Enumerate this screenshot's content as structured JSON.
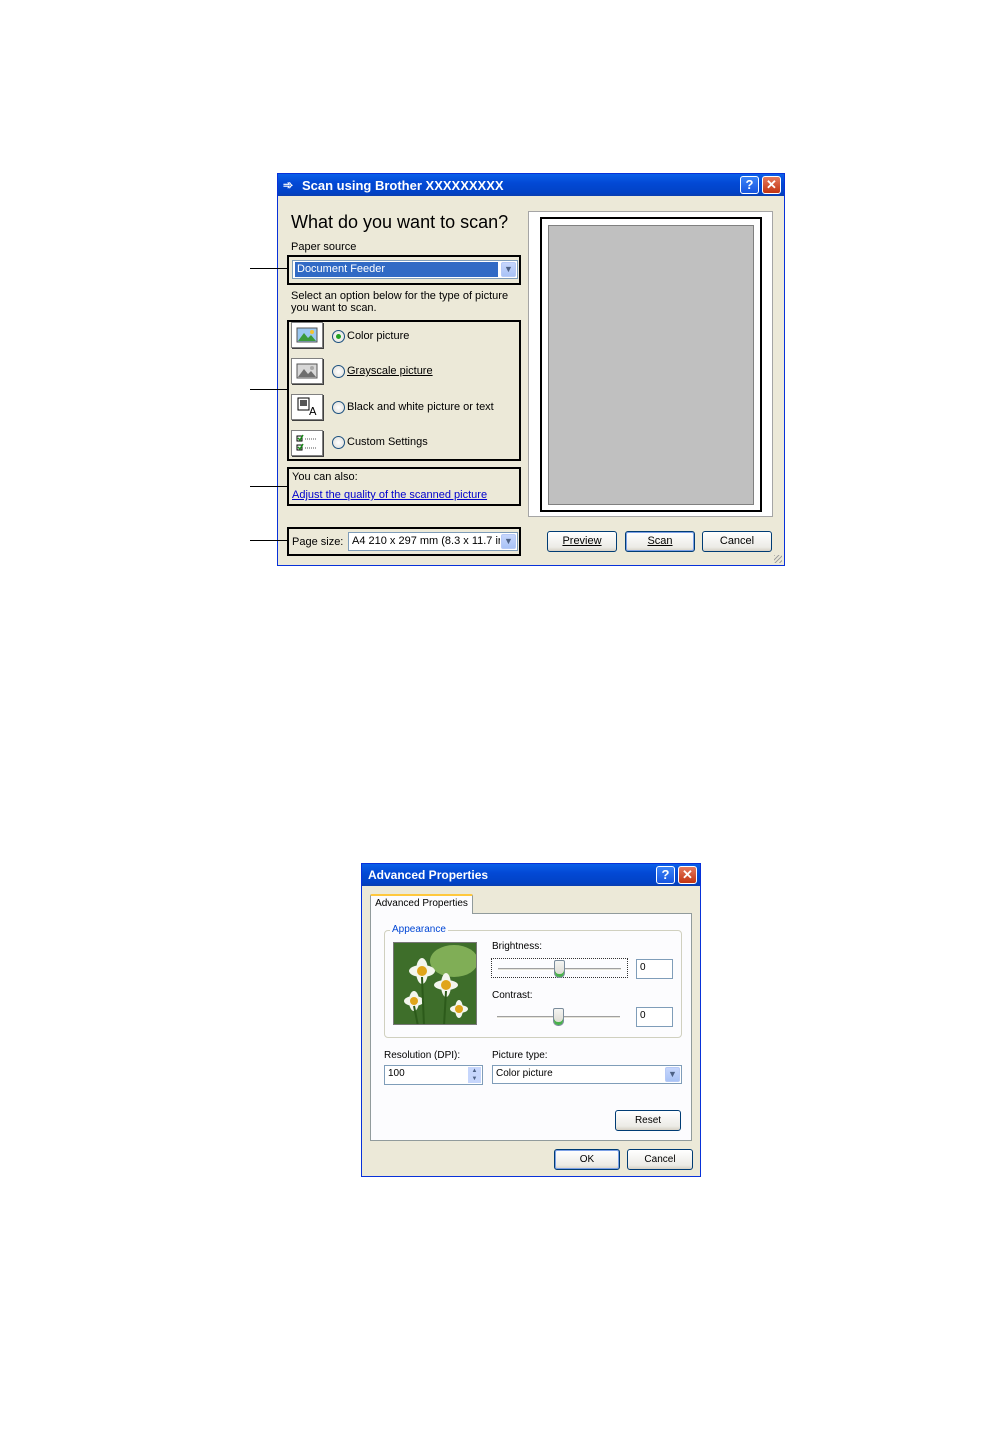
{
  "scan_dialog": {
    "title": "Scan using Brother XXXXXXXXX",
    "heading": "What do you want to scan?",
    "paper_source_label": "Paper source",
    "paper_source_value": "Document Feeder",
    "instructions": "Select an option below for the type of picture you want to scan.",
    "options": [
      {
        "label": "Color picture",
        "selected": true,
        "icon": "color-picture-icon"
      },
      {
        "label": "Grayscale picture",
        "selected": false,
        "icon": "grayscale-picture-icon"
      },
      {
        "label": "Black and white picture or text",
        "selected": false,
        "icon": "black-white-text-icon"
      },
      {
        "label": "Custom Settings",
        "selected": false,
        "icon": "custom-settings-icon"
      }
    ],
    "you_can_also": "You can also:",
    "adjust_link": "Adjust the quality of the scanned picture",
    "page_size_label": "Page size:",
    "page_size_value": "A4 210 x 297 mm (8.3 x 11.7 inc",
    "preview_button": "Preview",
    "scan_button": "Scan",
    "cancel_button": "Cancel",
    "help_glyph": "?",
    "close_glyph": "✕"
  },
  "advanced_dialog": {
    "title": "Advanced Properties",
    "tab": "Advanced Properties",
    "appearance_group": "Appearance",
    "brightness_label": "Brightness:",
    "brightness_value": "0",
    "brightness_level": 0.5,
    "contrast_label": "Contrast:",
    "contrast_value": "0",
    "contrast_level": 0.5,
    "resolution_label": "Resolution (DPI):",
    "resolution_value": "100",
    "picture_type_label": "Picture type:",
    "picture_type_value": "Color picture",
    "reset_button": "Reset",
    "ok_button": "OK",
    "cancel_button": "Cancel",
    "help_glyph": "?",
    "close_glyph": "✕"
  },
  "colors": {
    "titlebar": "#0A5FE8",
    "dialog_face": "#ECE9D8",
    "link": "#0000CC",
    "group_label": "#0046D5",
    "selection": "#316AC5"
  }
}
